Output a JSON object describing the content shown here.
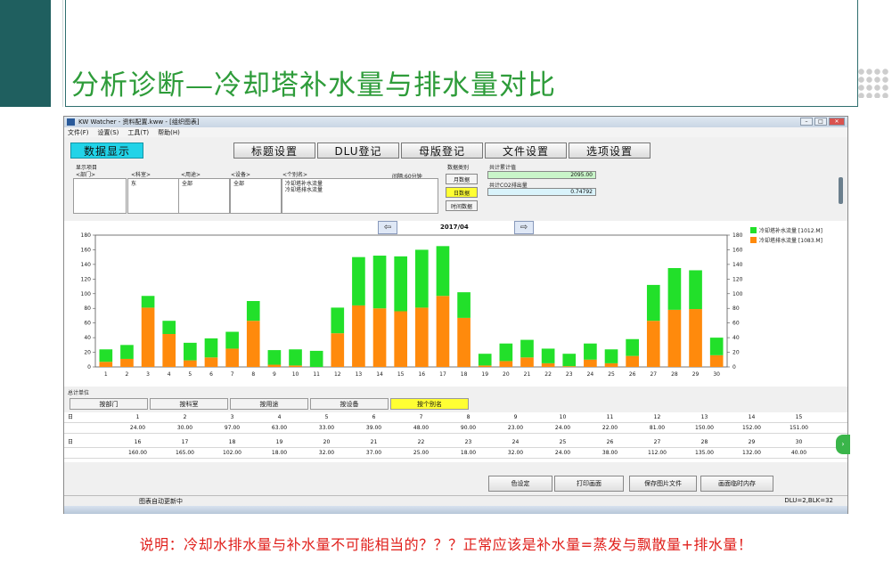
{
  "slide": {
    "title": "分析诊断—冷却塔补水量与排水量对比",
    "note": "说明：冷却水排水量与补水量不可能相当的？？？正常应该是补水量=蒸发与飘散量+排水量！"
  },
  "app": {
    "window_title": "KW Watcher - 资料配置.kww - [组织图表]",
    "menu": [
      "文件(F)",
      "设置(S)",
      "工具(T)",
      "帮助(H)"
    ],
    "toolbar": [
      "数据显示",
      "标题设置",
      "DLU登记",
      "母版登记",
      "文件设置",
      "选项设置"
    ],
    "filters": {
      "section_label": "显示项目",
      "dept_label": "<部门>",
      "room_label": "<科室>",
      "use_label": "<用途>",
      "device_label": "<设备>",
      "alias_label": "<个别名>",
      "interval_label": "间隔:60分钟",
      "dept_value": "",
      "room_value": "东",
      "use_value": "全部",
      "device_value": "全部",
      "alias_items": [
        "冷却塔补水流量",
        "冷却塔排水流量"
      ]
    },
    "data_type": {
      "label": "数据类别",
      "options": [
        "月数据",
        "日数据",
        "时间数据"
      ],
      "selected": "日数据"
    },
    "stats": {
      "total_label": "共计累计值",
      "total_value": "2095.00",
      "co2_label": "共计CO2排出量",
      "co2_value": "0.74792"
    },
    "group": {
      "label": "总计单位",
      "buttons": [
        "按部门",
        "按科室",
        "按用途",
        "按设备",
        "按个别名"
      ],
      "selected": "按个别名"
    },
    "table": {
      "row_label": "日",
      "rows": [
        {
          "days": [
            "1",
            "2",
            "3",
            "4",
            "5",
            "6",
            "7",
            "8",
            "9",
            "10",
            "11",
            "12",
            "13",
            "14",
            "15"
          ],
          "values": [
            "24.00",
            "30.00",
            "97.00",
            "63.00",
            "33.00",
            "39.00",
            "48.00",
            "90.00",
            "23.00",
            "24.00",
            "22.00",
            "81.00",
            "150.00",
            "152.00",
            "151.00"
          ]
        },
        {
          "days": [
            "16",
            "17",
            "18",
            "19",
            "20",
            "21",
            "22",
            "23",
            "24",
            "25",
            "26",
            "27",
            "28",
            "29",
            "30"
          ],
          "values": [
            "160.00",
            "165.00",
            "102.00",
            "18.00",
            "32.00",
            "37.00",
            "25.00",
            "18.00",
            "32.00",
            "24.00",
            "38.00",
            "112.00",
            "135.00",
            "132.00",
            "40.00"
          ]
        }
      ]
    },
    "bottom_buttons": [
      "色设定",
      "打印画面",
      "保存图片文件",
      "画面临时内存"
    ],
    "status_left": "图表自动更新中",
    "status_right": "DLU=2,BLK=32"
  },
  "chart_data": {
    "type": "bar",
    "stacked": true,
    "title": "2017/04",
    "categories": [
      "1",
      "2",
      "3",
      "4",
      "5",
      "6",
      "7",
      "8",
      "9",
      "10",
      "11",
      "12",
      "13",
      "14",
      "15",
      "16",
      "17",
      "18",
      "19",
      "20",
      "21",
      "22",
      "23",
      "24",
      "25",
      "26",
      "27",
      "28",
      "29",
      "30"
    ],
    "series": [
      {
        "name": "冷却塔补水流量 [1012.M]",
        "color": "#22e02a",
        "values": [
          17,
          19,
          16,
          18,
          24,
          26,
          23,
          27,
          20,
          22,
          22,
          35,
          66,
          72,
          75,
          79,
          68,
          35,
          16,
          24,
          24,
          20,
          17,
          22,
          19,
          23,
          49,
          57,
          53,
          24
        ]
      },
      {
        "name": "冷却塔排水流量 [1083.M]",
        "color": "#ff8a0c",
        "values": [
          7,
          11,
          81,
          45,
          9,
          13,
          25,
          63,
          3,
          2,
          0,
          46,
          84,
          80,
          76,
          81,
          97,
          67,
          2,
          8,
          13,
          5,
          1,
          10,
          5,
          15,
          63,
          78,
          79,
          16
        ]
      }
    ],
    "ylim": [
      0,
      180
    ],
    "yticks": [
      0,
      20,
      40,
      60,
      80,
      100,
      120,
      140,
      160,
      180
    ],
    "grid": false,
    "legend": "top-right"
  }
}
